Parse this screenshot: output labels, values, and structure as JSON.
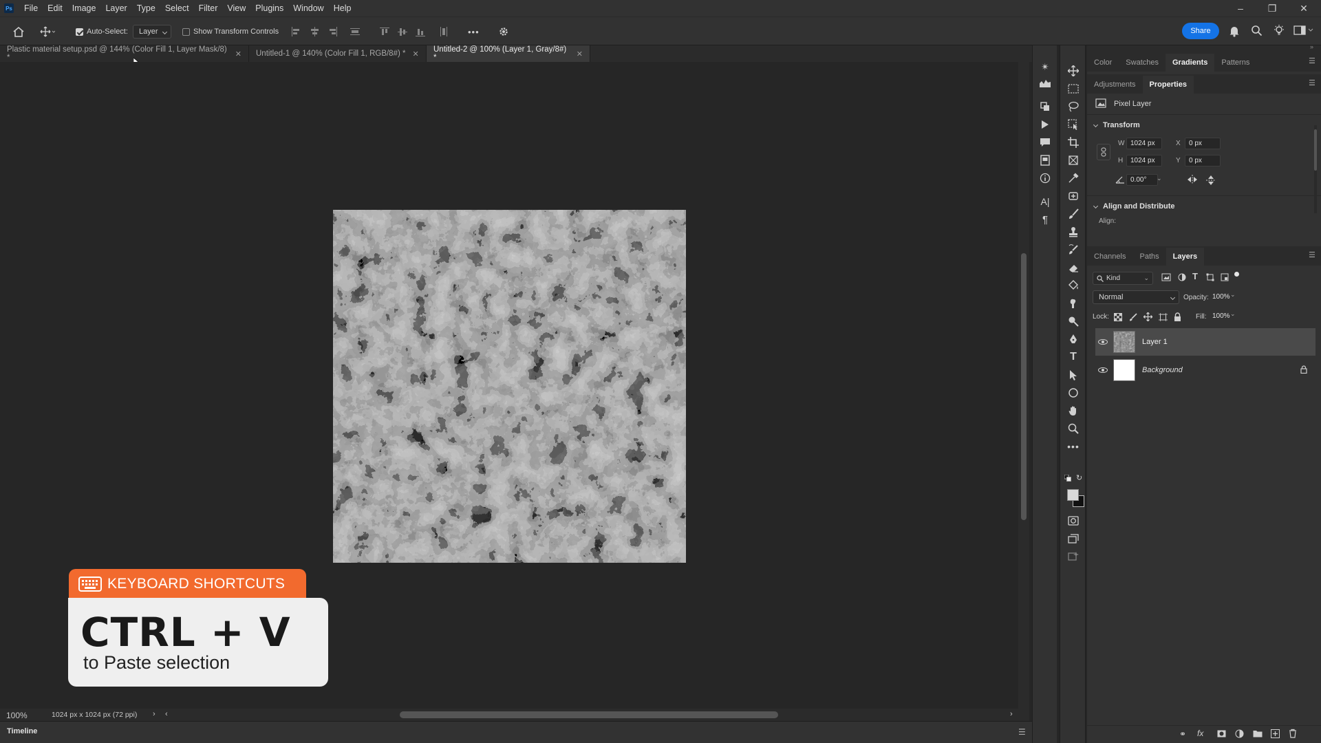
{
  "app": {
    "logo": "Ps",
    "menu": [
      "File",
      "Edit",
      "Image",
      "Layer",
      "Type",
      "Select",
      "Filter",
      "View",
      "Plugins",
      "Window",
      "Help"
    ]
  },
  "options": {
    "auto_select_label": "Auto-Select:",
    "auto_select_checked": true,
    "target": "Layer",
    "show_transform_label": "Show Transform Controls",
    "more": "•••",
    "share": "Share"
  },
  "tabs": [
    {
      "label": "Plastic material setup.psd @ 144% (Color Fill 1, Layer Mask/8) *",
      "active": false
    },
    {
      "label": "Untitled-1 @ 140% (Color Fill 1, RGB/8#) *",
      "active": false
    },
    {
      "label": "Untitled-2 @ 100% (Layer 1, Gray/8#) *",
      "active": true
    }
  ],
  "status": {
    "zoom": "100%",
    "doc_info": "1024 px x 1024 px (72 ppi)",
    "timeline": "Timeline"
  },
  "panels": {
    "top_tabs": [
      {
        "label": "Color",
        "active": false
      },
      {
        "label": "Swatches",
        "active": false
      },
      {
        "label": "Gradients",
        "active": true
      },
      {
        "label": "Patterns",
        "active": false
      }
    ],
    "mid_tabs": [
      {
        "label": "Adjustments",
        "active": false
      },
      {
        "label": "Properties",
        "active": true
      }
    ],
    "properties": {
      "layer_kind": "Pixel Layer",
      "transform_title": "Transform",
      "w_label": "W",
      "w": "1024 px",
      "h_label": "H",
      "h": "1024 px",
      "x_label": "X",
      "x": "0 px",
      "y_label": "Y",
      "y": "0 px",
      "angle": "0.00°",
      "align_title": "Align and Distribute",
      "align_label": "Align:"
    },
    "layers_tabs": [
      {
        "label": "Channels",
        "active": false
      },
      {
        "label": "Paths",
        "active": false
      },
      {
        "label": "Layers",
        "active": true
      }
    ],
    "layers": {
      "filter_kind": "Kind",
      "blend_mode": "Normal",
      "opacity_label": "Opacity:",
      "opacity": "100%",
      "lock_label": "Lock:",
      "fill_label": "Fill:",
      "fill": "100%",
      "items": [
        {
          "name": "Layer 1",
          "selected": true,
          "locked": false
        },
        {
          "name": "Background",
          "selected": false,
          "locked": true
        }
      ]
    }
  },
  "overlay": {
    "header": "KEYBOARD SHORTCUTS",
    "keys": "CTRL + V",
    "description": "to Paste selection"
  },
  "colors": {
    "accent": "#f26a2e",
    "share": "#1473e6",
    "background": "#262626",
    "panel": "#323232"
  }
}
